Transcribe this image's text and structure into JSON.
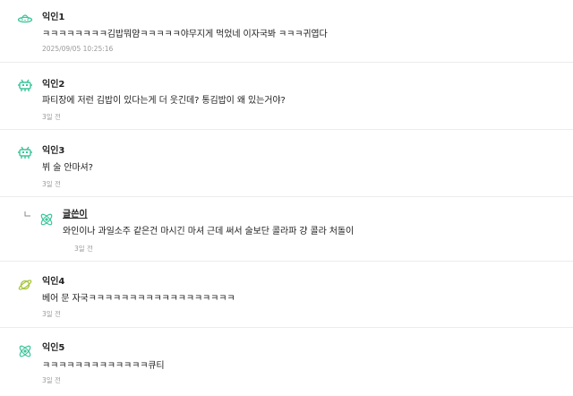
{
  "comments": [
    {
      "author": "익인1",
      "text": "ㅋㅋㅋㅋㅋㅋㅋㅋ김밥뭐얌ㅋㅋㅋㅋㅋ야무지게 먹었네 이자국봐 ㅋㅋㅋ귀엽다",
      "date": "2025/09/05 10:25:16",
      "avatar_icon": "ufo-icon",
      "avatar_color": "#3cc59a"
    },
    {
      "author": "익인2",
      "text": "파티장에 저런 김밥이 있다는게 더 웃긴데? 통김밥이 왜 있는거야?",
      "date": "3일 전",
      "avatar_icon": "space-invader-icon",
      "avatar_color": "#3cc59a"
    },
    {
      "author": "익인3",
      "text": "뷔 술 안마셔?",
      "date": "3일 전",
      "avatar_icon": "space-invader-icon",
      "avatar_color": "#3cc59a"
    },
    {
      "author": "글쓴이",
      "text": "와인이나 과일소주 같은건 마시긴 마셔 근데 써서 술보단 콜라파 걍 콜라 처돌이",
      "date": "3일 전",
      "avatar_icon": "atom-icon",
      "avatar_color": "#3cc59a",
      "is_reply": true,
      "is_writer": true
    },
    {
      "author": "익인4",
      "text": "베어 문 자국ㅋㅋㅋㅋㅋㅋㅋㅋㅋㅋㅋㅋㅋㅋㅋㅋㅋㅋ",
      "date": "3일 전",
      "avatar_icon": "planet-icon",
      "avatar_color": "#a5c43a"
    },
    {
      "author": "익인5",
      "text": "ㅋㅋㅋㅋㅋㅋㅋㅋㅋㅋㅋㅋㅋ큐티",
      "date": "3일 전",
      "avatar_icon": "atom-icon",
      "avatar_color": "#3cc59a"
    }
  ]
}
